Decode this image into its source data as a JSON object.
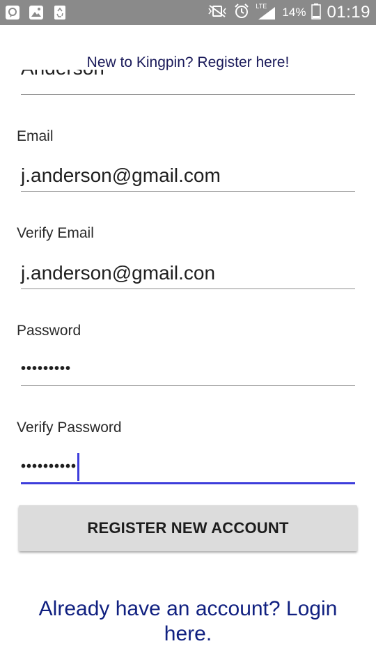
{
  "status_bar": {
    "battery_percent": "14%",
    "network": "LTE",
    "time": "01:19"
  },
  "form": {
    "register_prompt": "New to Kingpin? Register here!",
    "last_name_value": "Anderson",
    "email_label": "Email",
    "email_value": "j.anderson@gmail.com",
    "verify_email_label": "Verify Email",
    "verify_email_value": "j.anderson@gmail.con",
    "password_label": "Password",
    "password_value": "•••••••••",
    "verify_password_label": "Verify Password",
    "verify_password_value": "••••••••••",
    "register_button": "REGISTER NEW ACCOUNT",
    "login_prompt": "Already have an account? Login here."
  },
  "colors": {
    "accent": "#3d3ddb",
    "link": "#102080",
    "button_bg": "#dcdcdc",
    "status_bar_bg": "#8a8a8a"
  }
}
